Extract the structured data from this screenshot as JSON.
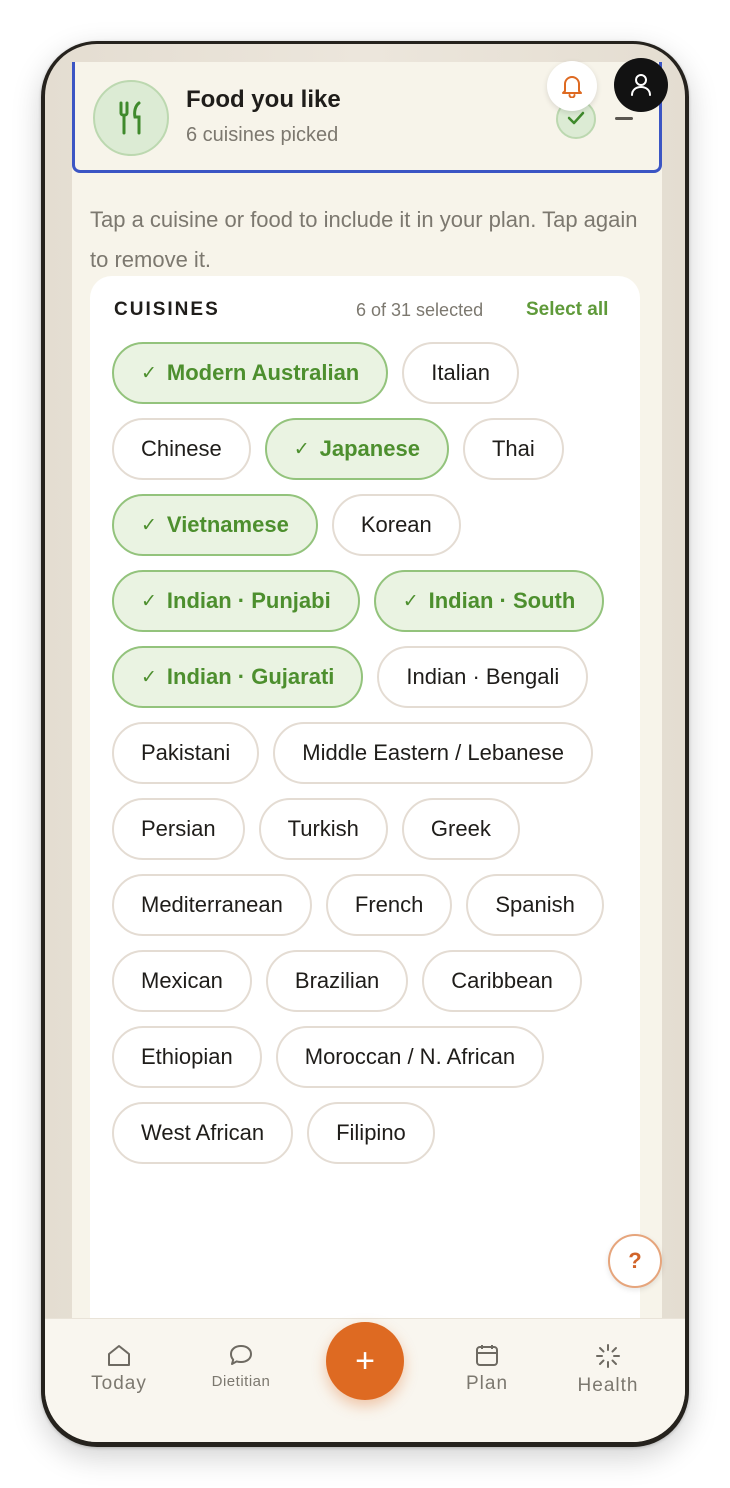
{
  "header": {
    "title": "Food you like",
    "subtitle": "6 cuisines picked"
  },
  "hint": "Tap a cuisine or food to include it in your plan. Tap again to remove it.",
  "cuisines": {
    "title": "CUISINES",
    "count": "6 of 31 selected",
    "select_all": "Select all",
    "check_mark": "✓",
    "items": [
      {
        "label": "Modern Australian",
        "selected": true
      },
      {
        "label": "Italian",
        "selected": false
      },
      {
        "label": "Chinese",
        "selected": false
      },
      {
        "label": "Japanese",
        "selected": true
      },
      {
        "label": "Thai",
        "selected": false
      },
      {
        "label": "Vietnamese",
        "selected": true
      },
      {
        "label": "Korean",
        "selected": false
      },
      {
        "label": "Indian · Punjabi",
        "selected": true
      },
      {
        "label": "Indian · South",
        "selected": true
      },
      {
        "label": "Indian · Gujarati",
        "selected": true
      },
      {
        "label": "Indian · Bengali",
        "selected": false
      },
      {
        "label": "Pakistani",
        "selected": false
      },
      {
        "label": "Middle Eastern / Lebanese",
        "selected": false
      },
      {
        "label": "Persian",
        "selected": false
      },
      {
        "label": "Turkish",
        "selected": false
      },
      {
        "label": "Greek",
        "selected": false
      },
      {
        "label": "Mediterranean",
        "selected": false
      },
      {
        "label": "French",
        "selected": false
      },
      {
        "label": "Spanish",
        "selected": false
      },
      {
        "label": "Mexican",
        "selected": false
      },
      {
        "label": "Brazilian",
        "selected": false
      },
      {
        "label": "Caribbean",
        "selected": false
      },
      {
        "label": "Ethiopian",
        "selected": false
      },
      {
        "label": "Moroccan / N. African",
        "selected": false
      },
      {
        "label": "West African",
        "selected": false
      },
      {
        "label": "Filipino",
        "selected": false
      }
    ]
  },
  "help_label": "?",
  "fab_label": "+",
  "tabs": {
    "today": "Today",
    "dietitian": "Dietitian",
    "plan": "Plan",
    "health": "Health"
  },
  "colors": {
    "accent_green": "#5f9a3a",
    "accent_orange": "#de6a22",
    "focus_border": "#3b55c4"
  }
}
